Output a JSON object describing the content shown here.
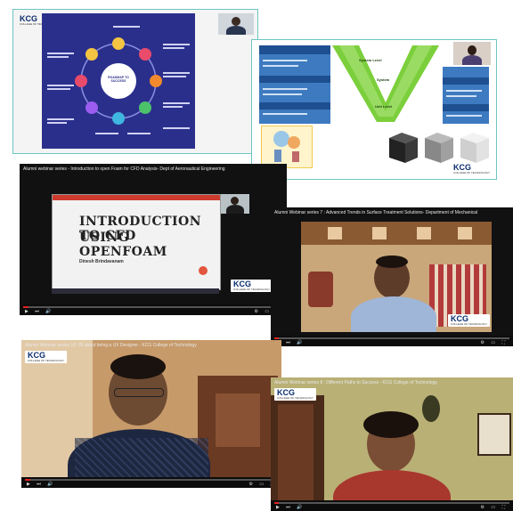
{
  "brand": {
    "logo_text": "KCG",
    "logo_sub": "COLLEGE OF TECHNOLOGY",
    "accent": "#0a2d6e"
  },
  "slide_roadmap": {
    "center_text": "ROADMAP TO SUCCESS"
  },
  "slide_vmodel": {
    "labels": [
      "System Level",
      "System",
      "Unit Level"
    ]
  },
  "webinar_cfd": {
    "title": "Alumni webinar series - Introduction to open Foam for CFD Analysis- Dept of Aeronautical Engineering",
    "slide_title_line1": "INTRODUCTION TO CFD",
    "slide_title_line2": "USING OPENFOAM",
    "presenter": "Dinesh Brindavanam",
    "progress": 0.02
  },
  "webinar_surface": {
    "title": "Alumni Webinar series 7 : Advanced Trends in Surface Treatment Solutions- Department of Mechanical",
    "progress": 0.02
  },
  "webinar_designer": {
    "title": "Alumni Webinar series 10 : Bi about being a UX Designer - KCG College of Technology",
    "progress": 0.02
  },
  "webinar_pathways": {
    "title": "Alumni Webinar series 8 : Different Paths to Success - KCG College of Technology",
    "progress": 0.02
  },
  "player": {
    "control_icons": "▶ ⏭ 🔊",
    "right_icons": "⚙ ▭ ⛶"
  }
}
